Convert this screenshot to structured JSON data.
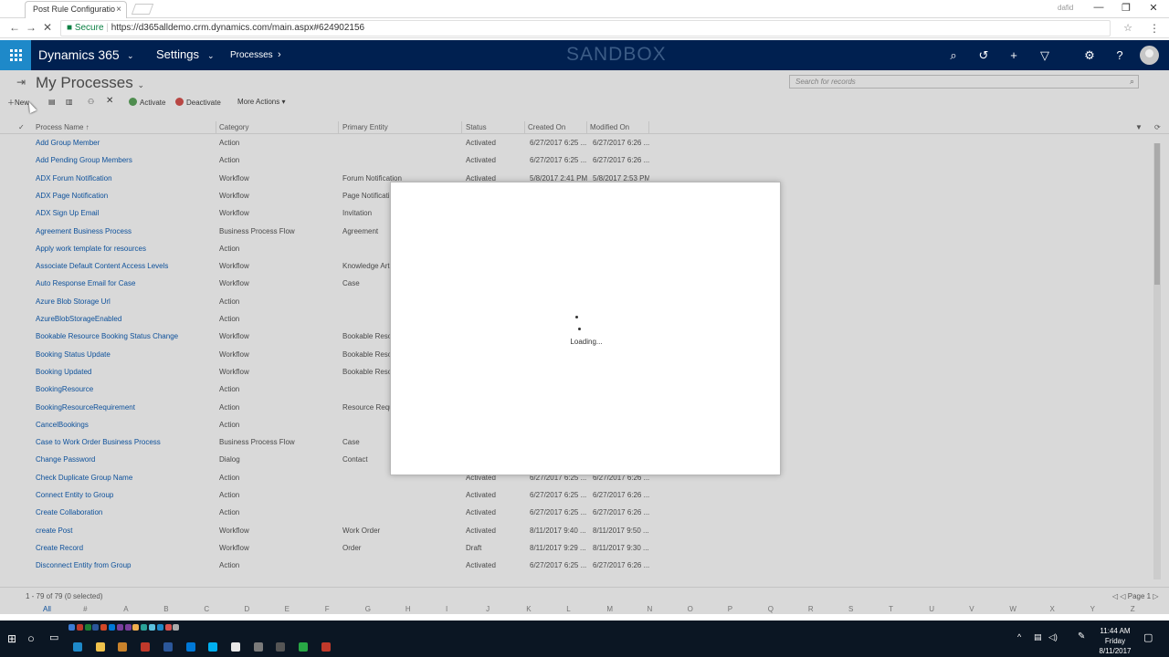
{
  "browser": {
    "tab_title": "Post Rule Configuratio",
    "tab_close": "×",
    "profile": "dafid",
    "secure_label": "Secure",
    "url": "https://d365alldemo.crm.dynamics.com/main.aspx#624902156",
    "win_min": "—",
    "win_max": "❐",
    "win_close": "✕"
  },
  "app": {
    "name": "Dynamics 365",
    "area": "Settings",
    "breadcrumb": "Processes",
    "environment_banner": "SANDBOX"
  },
  "page": {
    "title": "My Processes",
    "search_placeholder": "Search for records"
  },
  "toolbar": {
    "new_label": "New",
    "activate_label": "Activate",
    "deactivate_label": "Deactivate",
    "more_actions_label": "More Actions"
  },
  "grid": {
    "columns": {
      "name": "Process Name ↑",
      "category": "Category",
      "entity": "Primary Entity",
      "status": "Status",
      "created": "Created On",
      "modified": "Modified On"
    },
    "rows": [
      {
        "name": "Add Group Member",
        "category": "Action",
        "entity": "",
        "status": "Activated",
        "created": "6/27/2017 6:25 ...",
        "modified": "6/27/2017 6:26 ..."
      },
      {
        "name": "Add Pending Group Members",
        "category": "Action",
        "entity": "",
        "status": "Activated",
        "created": "6/27/2017 6:25 ...",
        "modified": "6/27/2017 6:26 ..."
      },
      {
        "name": "ADX Forum Notification",
        "category": "Workflow",
        "entity": "Forum Notification",
        "status": "Activated",
        "created": "5/8/2017 2:41 PM",
        "modified": "5/8/2017 2:53 PM"
      },
      {
        "name": "ADX Page Notification",
        "category": "Workflow",
        "entity": "Page Notification",
        "status": "",
        "created": "",
        "modified": ""
      },
      {
        "name": "ADX Sign Up Email",
        "category": "Workflow",
        "entity": "Invitation",
        "status": "",
        "created": "",
        "modified": ""
      },
      {
        "name": "Agreement Business Process",
        "category": "Business Process Flow",
        "entity": "Agreement",
        "status": "",
        "created": "",
        "modified": ""
      },
      {
        "name": "Apply work template for resources",
        "category": "Action",
        "entity": "",
        "status": "",
        "created": "",
        "modified": ""
      },
      {
        "name": "Associate Default Content Access Levels",
        "category": "Workflow",
        "entity": "Knowledge Article",
        "status": "",
        "created": "",
        "modified": ""
      },
      {
        "name": "Auto Response Email for Case",
        "category": "Workflow",
        "entity": "Case",
        "status": "",
        "created": "",
        "modified": ""
      },
      {
        "name": "Azure Blob Storage Url",
        "category": "Action",
        "entity": "",
        "status": "",
        "created": "",
        "modified": ""
      },
      {
        "name": "AzureBlobStorageEnabled",
        "category": "Action",
        "entity": "",
        "status": "",
        "created": "",
        "modified": ""
      },
      {
        "name": "Bookable Resource Booking Status Change",
        "category": "Workflow",
        "entity": "Bookable Resource",
        "status": "",
        "created": "",
        "modified": ""
      },
      {
        "name": "Booking Status Update",
        "category": "Workflow",
        "entity": "Bookable Resource",
        "status": "",
        "created": "",
        "modified": ""
      },
      {
        "name": "Booking Updated",
        "category": "Workflow",
        "entity": "Bookable Resource",
        "status": "",
        "created": "",
        "modified": ""
      },
      {
        "name": "BookingResource",
        "category": "Action",
        "entity": "",
        "status": "",
        "created": "",
        "modified": ""
      },
      {
        "name": "BookingResourceRequirement",
        "category": "Action",
        "entity": "Resource Requirement",
        "status": "",
        "created": "",
        "modified": ""
      },
      {
        "name": "CancelBookings",
        "category": "Action",
        "entity": "",
        "status": "",
        "created": "",
        "modified": ""
      },
      {
        "name": "Case to Work Order Business Process",
        "category": "Business Process Flow",
        "entity": "Case",
        "status": "",
        "created": "",
        "modified": ""
      },
      {
        "name": "Change Password",
        "category": "Dialog",
        "entity": "Contact",
        "status": "",
        "created": "",
        "modified": ""
      },
      {
        "name": "Check Duplicate Group Name",
        "category": "Action",
        "entity": "",
        "status": "Activated",
        "created": "6/27/2017 6:25 ...",
        "modified": "6/27/2017 6:26 ..."
      },
      {
        "name": "Connect Entity to Group",
        "category": "Action",
        "entity": "",
        "status": "Activated",
        "created": "6/27/2017 6:25 ...",
        "modified": "6/27/2017 6:26 ..."
      },
      {
        "name": "Create Collaboration",
        "category": "Action",
        "entity": "",
        "status": "Activated",
        "created": "6/27/2017 6:25 ...",
        "modified": "6/27/2017 6:26 ..."
      },
      {
        "name": "create Post",
        "category": "Workflow",
        "entity": "Work Order",
        "status": "Activated",
        "created": "8/11/2017 9:40 ...",
        "modified": "8/11/2017 9:50 ..."
      },
      {
        "name": "Create Record",
        "category": "Workflow",
        "entity": "Order",
        "status": "Draft",
        "created": "8/11/2017 9:29 ...",
        "modified": "8/11/2017 9:30 ..."
      },
      {
        "name": "Disconnect Entity from Group",
        "category": "Action",
        "entity": "",
        "status": "Activated",
        "created": "6/27/2017 6:25 ...",
        "modified": "6/27/2017 6:26 ..."
      }
    ],
    "record_count": "1 - 79 of 79 (0 selected)",
    "pager": "◁ ◁ Page 1 ▷",
    "alpha_filters": [
      "All",
      "#",
      "A",
      "B",
      "C",
      "D",
      "E",
      "F",
      "G",
      "H",
      "I",
      "J",
      "K",
      "L",
      "M",
      "N",
      "O",
      "P",
      "Q",
      "R",
      "S",
      "T",
      "U",
      "V",
      "W",
      "X",
      "Y",
      "Z"
    ]
  },
  "modal": {
    "loading_text": "Loading..."
  },
  "taskbar": {
    "time": "11:44 AM",
    "day": "Friday",
    "date": "8/11/2017"
  }
}
